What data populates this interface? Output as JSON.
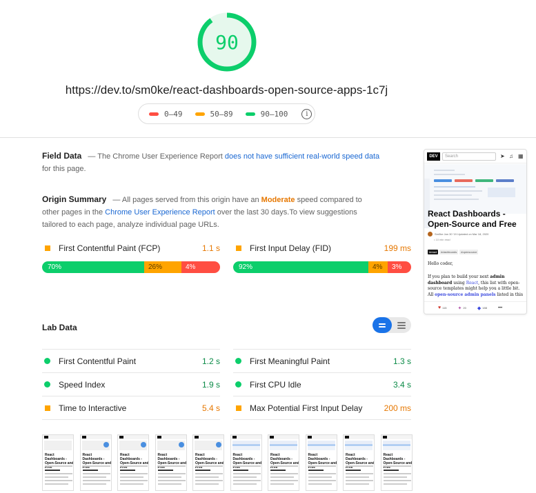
{
  "header": {
    "score": "90",
    "score_fraction": 0.9,
    "url": "https://dev.to/sm0ke/react-dashboards-open-source-apps-1c7j",
    "legend": [
      {
        "label": "0–49",
        "color": "#ff4e42"
      },
      {
        "label": "50–89",
        "color": "#ffa400"
      },
      {
        "label": "90–100",
        "color": "#0cce6b"
      }
    ],
    "info_icon": "info-icon"
  },
  "field_data": {
    "title": "Field Data",
    "text_before": "— The Chrome User Experience Report",
    "link": "does not have sufficient real-world speed data",
    "text_after": "for this page."
  },
  "origin_summary": {
    "title": "Origin Summary",
    "text1": "— All pages served from this origin have an",
    "rating": "Moderate",
    "text2": "speed compared to other pages in the",
    "link": "Chrome User Experience Report",
    "text3": "over the last 30 days.To view suggestions tailored to each page, analyze individual page URLs.",
    "metrics": [
      {
        "label": "First Contentful Paint (FCP)",
        "value": "1.1 s",
        "fast": "70%",
        "average": "26%",
        "slow": "4%",
        "fast_pct": 70,
        "average_pct": 26,
        "slow_pct": 4
      },
      {
        "label": "First Input Delay (FID)",
        "value": "199 ms",
        "fast": "92%",
        "average": "4%",
        "slow": "3%",
        "fast_pct": 92,
        "average_pct": 4,
        "slow_pct": 3
      }
    ]
  },
  "lab_data": {
    "title": "Lab Data",
    "left": [
      {
        "label": "First Contentful Paint",
        "value": "1.2 s",
        "status": "good"
      },
      {
        "label": "Speed Index",
        "value": "1.9 s",
        "status": "good"
      },
      {
        "label": "Time to Interactive",
        "value": "5.4 s",
        "status": "average"
      }
    ],
    "right": [
      {
        "label": "First Meaningful Paint",
        "value": "1.3 s",
        "status": "good"
      },
      {
        "label": "First CPU Idle",
        "value": "3.4 s",
        "status": "good"
      },
      {
        "label": "Max Potential First Input Delay",
        "value": "200 ms",
        "status": "average"
      }
    ]
  },
  "filmstrip": {
    "frame_title": "React Dashboards - Open-Source and Free",
    "frame_count": 10
  },
  "screenshot": {
    "logo": "DEV",
    "search_placeholder": "Search",
    "title": "React Dashboards - Open-Source and Free",
    "meta": "Sm0ke  Jan 30 '19  Updated on Mar 18, 2020",
    "min_read": "• 10 min read",
    "tags": [
      "#react",
      "#dashboards",
      "#opensource"
    ],
    "greeting": "Hello coder,",
    "body_1": "If you plan to build your next",
    "body_bold": "admin dashboard",
    "body_2": "using",
    "body_link": "React",
    "body_3": ", this list with open-source templates might help you a little bit. All",
    "body_link2": "open-source admin panels",
    "body_4": "listed in this",
    "reactions": [
      "115",
      "20",
      "188"
    ],
    "more": "•••"
  },
  "colors": {
    "pass": "#0cce6b",
    "average": "#ffa400",
    "fail": "#ff4e42",
    "link": "#1967d2",
    "toggle_active": "#1a73e8"
  }
}
